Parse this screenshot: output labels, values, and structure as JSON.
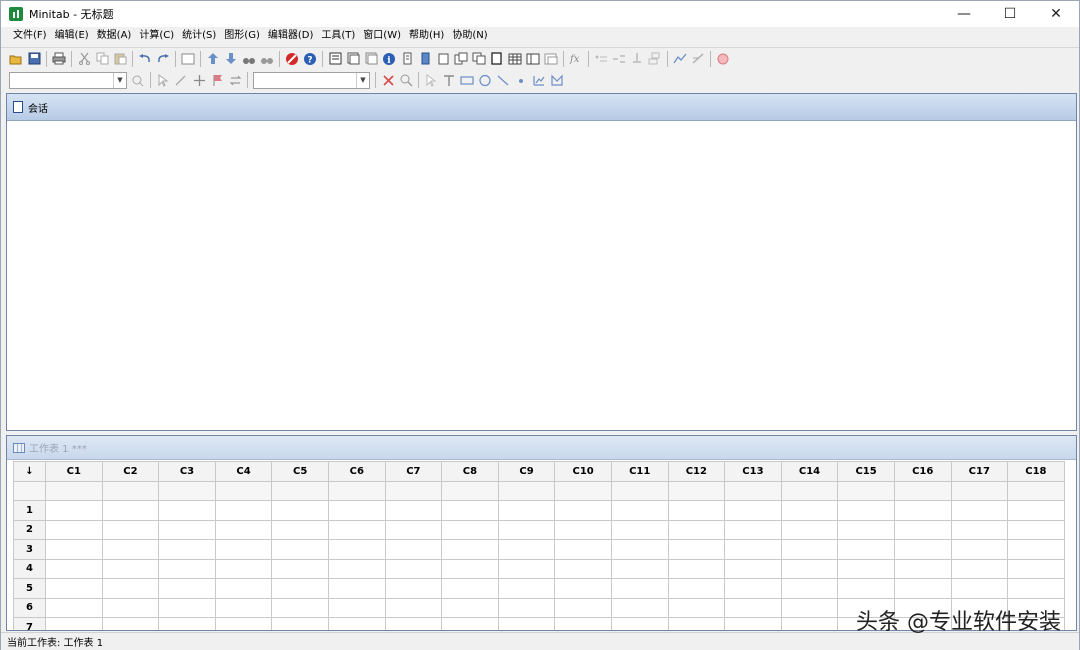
{
  "window": {
    "title": "Minitab - 无标题",
    "minimize": "—",
    "maximize": "☐",
    "close": "✕"
  },
  "menu": [
    "文件(F)",
    "编辑(E)",
    "数据(A)",
    "计算(C)",
    "统计(S)",
    "图形(G)",
    "编辑器(D)",
    "工具(T)",
    "窗口(W)",
    "帮助(H)",
    "协助(N)"
  ],
  "session": {
    "title": "会话"
  },
  "worksheet": {
    "title": "工作表 1 ***",
    "corner": "↓",
    "columns": [
      "C1",
      "C2",
      "C3",
      "C4",
      "C5",
      "C6",
      "C7",
      "C8",
      "C9",
      "C10",
      "C11",
      "C12",
      "C13",
      "C14",
      "C15",
      "C16",
      "C17",
      "C18"
    ],
    "rows": [
      "1",
      "2",
      "3",
      "4",
      "5",
      "6",
      "7"
    ]
  },
  "status": {
    "text": "当前工作表: 工作表 1"
  },
  "watermark": "头条 @专业软件安装",
  "colors": {
    "accent": "#1e8a3c",
    "window_border": "#6f86a8",
    "title_gradient_top": "#d6e3f3"
  }
}
